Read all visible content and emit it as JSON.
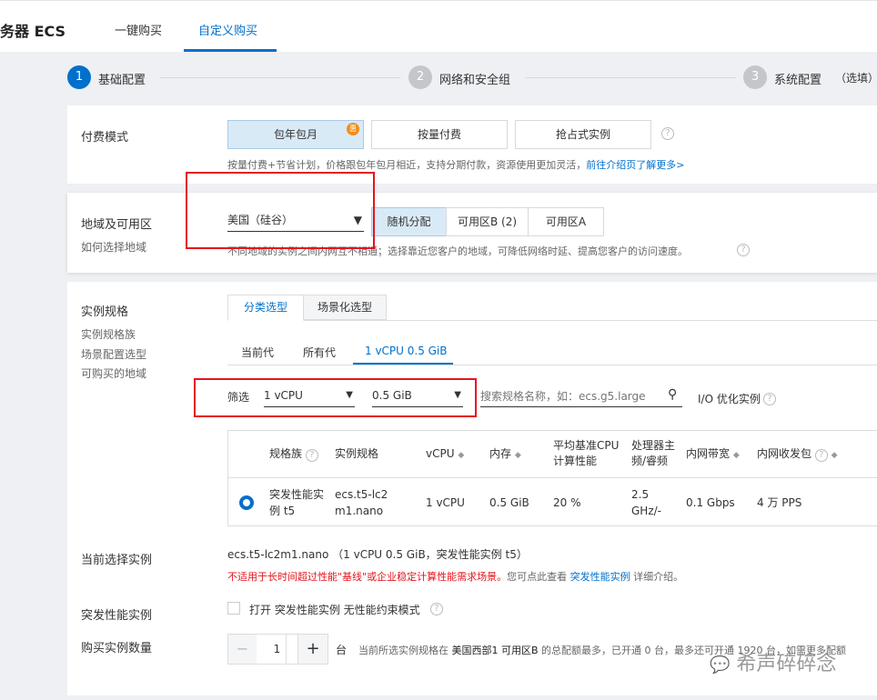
{
  "header": {
    "title": "务器 ECS",
    "tabs": [
      {
        "label": "一键购买"
      },
      {
        "label": "自定义购买"
      }
    ]
  },
  "steps": [
    {
      "num": "1",
      "label": "基础配置"
    },
    {
      "num": "2",
      "label": "网络和安全组"
    },
    {
      "num": "3",
      "label": "系统配置",
      "note": "（选填）"
    }
  ],
  "billing": {
    "label": "付费模式",
    "options": [
      "包年包月",
      "按量付费",
      "抢占式实例"
    ],
    "badge": "惠",
    "hint": "按量付费+节省计划，价格跟包年包月相近，支持分期付款，资源使用更加灵活，",
    "link": "前往介绍页了解更多>"
  },
  "region": {
    "label": "地域及可用区",
    "sublink": "如何选择地域",
    "value": "美国（硅谷）",
    "zones": [
      "随机分配",
      "可用区B (2)",
      "可用区A"
    ],
    "hint": "不同地域的实例之间内网互不相通；选择靠近您客户的地域，可降低网络时延、提高您客户的访问速度。"
  },
  "spec": {
    "label": "实例规格",
    "sublinks": [
      "实例规格族",
      "场景配置选型",
      "可购买的地域"
    ],
    "mode_tabs": [
      "分类选型",
      "场景化选型"
    ],
    "gen_tabs": [
      "当前代",
      "所有代",
      "1 vCPU 0.5 GiB"
    ],
    "filter_label": "筛选",
    "cpu": "1 vCPU",
    "mem": "0.5 GiB",
    "search_placeholder": "搜索规格名称，如：ecs.g5.large",
    "io_label": "I/O 优化实例",
    "columns": [
      "规格族",
      "实例规格",
      "vCPU",
      "内存",
      "平均基准CPU计算性能",
      "处理器主频/睿频",
      "内网带宽",
      "内网收发包"
    ],
    "row": {
      "family": "突发性能实例 t5",
      "spec": "ecs.t5-lc2m1.nano",
      "vcpu": "1 vCPU",
      "mem": "0.5 GiB",
      "baseline": "20 %",
      "freq": "2.5 GHz/-",
      "bw": "0.1 Gbps",
      "pps": "4 万 PPS"
    }
  },
  "current": {
    "label": "当前选择实例",
    "value": "ecs.t5-lc2m1.nano （1 vCPU 0.5 GiB，突发性能实例 t5）",
    "warn": "不适用于长时间超过性能\"基线\"或企业稳定计算性能需求场景。",
    "more_pre": "您可点此查看 ",
    "more_link": "突发性能实例",
    "more_post": " 详细介绍。"
  },
  "burst": {
    "label": "突发性能实例",
    "checkbox": "打开 突发性能实例 无性能约束模式"
  },
  "qty": {
    "label": "购买实例数量",
    "value": "1",
    "unit": "台",
    "hint_pre": "当前所选实例规格在 ",
    "hint_region": "美国西部1 可用区B",
    "hint_post": " 的总配额最多，已开通 0 台，最多还可开通 1920 台，如需更多配额"
  },
  "watermark": "希声碎碎念"
}
